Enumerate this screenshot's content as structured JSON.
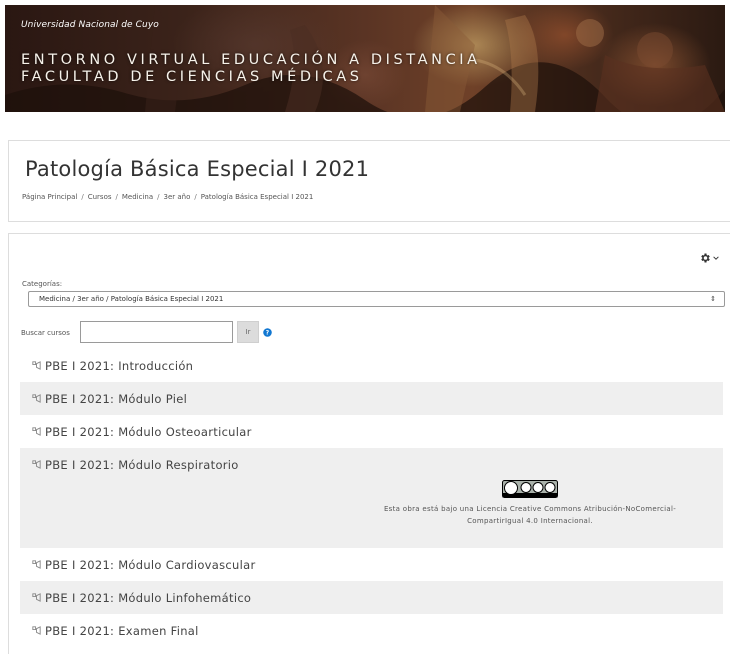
{
  "banner": {
    "university": "Universidad Nacional de Cuyo",
    "title_line1": "ENTORNO VIRTUAL EDUCACIÓN A DISTANCIA",
    "title_line2": "FACULTAD DE CIENCIAS MÉDICAS"
  },
  "page": {
    "title": "Patología Básica Especial I 2021",
    "breadcrumb": [
      "Página Principal",
      "Cursos",
      "Medicina",
      "3er año",
      "Patología Básica Especial I 2021"
    ]
  },
  "filters": {
    "categories_label": "Categorías:",
    "category_selected": "Medicina / 3er año / Patología Básica Especial I 2021",
    "search_label": "Buscar cursos",
    "search_value": "",
    "go_label": "Ir"
  },
  "courses": [
    "PBE I 2021: Introducción",
    "PBE I 2021: Módulo Piel",
    "PBE I 2021: Módulo Osteoarticular",
    "PBE I 2021: Módulo Respiratorio",
    "PBE I 2021: Módulo Cardiovascular",
    "PBE I 2021: Módulo Linfohemático",
    "PBE I 2021: Examen Final"
  ],
  "license": {
    "line1": "Esta obra está bajo una Licencia Creative Commons Atribución-NoComercial-",
    "line2": "CompartirIgual 4.0 Internacional."
  },
  "colors": {
    "accent": "#1177d1",
    "row_alt": "#efefef",
    "text": "#444444"
  }
}
